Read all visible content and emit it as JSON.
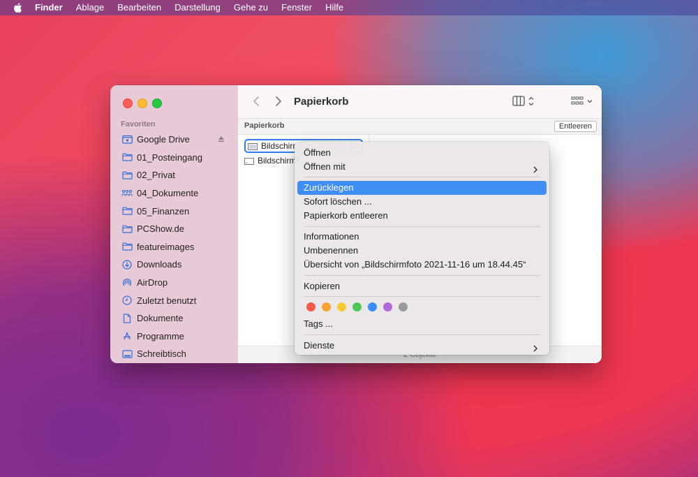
{
  "menubar": {
    "app": "Finder",
    "items": [
      "Ablage",
      "Bearbeiten",
      "Darstellung",
      "Gehe zu",
      "Fenster",
      "Hilfe"
    ]
  },
  "sidebar": {
    "heading": "Favoriten",
    "items": [
      {
        "label": "Google Drive",
        "icon": "drive-icon"
      },
      {
        "label": "01_Posteingang",
        "icon": "folder-icon"
      },
      {
        "label": "02_Privat",
        "icon": "folder-icon"
      },
      {
        "label": "04_Dokumente",
        "icon": "shared-folder-icon"
      },
      {
        "label": "05_Finanzen",
        "icon": "folder-icon"
      },
      {
        "label": "PCShow.de",
        "icon": "folder-icon"
      },
      {
        "label": "featureimages",
        "icon": "folder-icon"
      },
      {
        "label": "Downloads",
        "icon": "download-icon"
      },
      {
        "label": "AirDrop",
        "icon": "airdrop-icon"
      },
      {
        "label": "Zuletzt benutzt",
        "icon": "clock-icon"
      },
      {
        "label": "Dokumente",
        "icon": "document-icon"
      },
      {
        "label": "Programme",
        "icon": "apps-icon"
      },
      {
        "label": "Schreibtisch",
        "icon": "desktop-icon"
      }
    ]
  },
  "toolbar": {
    "title": "Papierkorb"
  },
  "pathbar": {
    "label": "Papierkorb",
    "empty_button": "Entleeren"
  },
  "files": [
    {
      "name": "Bildschirmfoto 2021-11-16 um 18.44.45"
    },
    {
      "name": "Bildschirmfoto"
    }
  ],
  "status": {
    "text": "2 Objekte"
  },
  "context_menu": {
    "open": "Öffnen",
    "open_with": "Öffnen mit",
    "put_back": "Zurücklegen",
    "delete_now": "Sofort löschen ...",
    "empty_trash": "Papierkorb entleeren",
    "info": "Informationen",
    "rename": "Umbenennen",
    "quicklook": "Übersicht von „Bildschirmfoto 2021-11-16 um 18.44.45“",
    "copy": "Kopieren",
    "tags": "Tags ...",
    "services": "Dienste",
    "tag_colors": [
      "#f25a4d",
      "#f7a136",
      "#f6cb32",
      "#4fc759",
      "#3c8df5",
      "#ad6ad8",
      "#9b9a9b"
    ]
  },
  "colors": {
    "accent": "#3e8ef5",
    "selection_border": "#2f7df6"
  }
}
